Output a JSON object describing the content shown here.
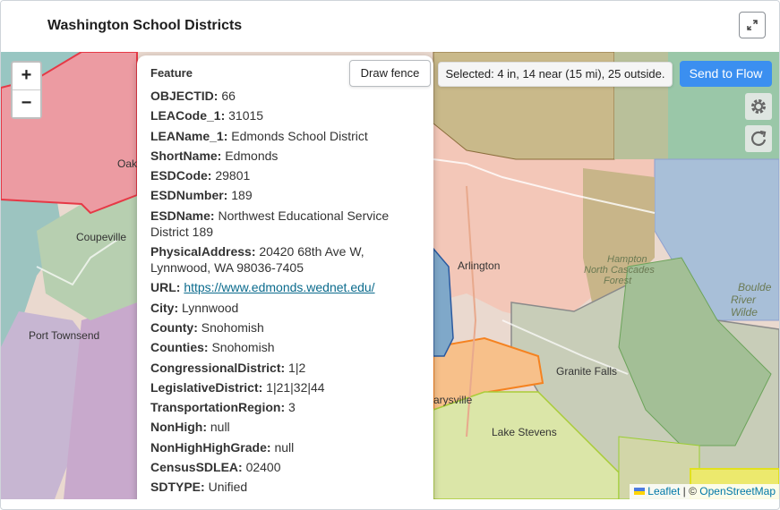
{
  "header": {
    "title": "Washington School Districts"
  },
  "map": {
    "zoom_in_label": "+",
    "zoom_out_label": "−",
    "place_labels": [
      "Oak",
      "Coupeville",
      "Port Townsend",
      "Arlington",
      "Hampton",
      "North Cascades",
      "Forest",
      "Boulde",
      "River Wilde",
      "Granite Falls",
      "arysville",
      "Lake Stevens"
    ]
  },
  "popup": {
    "heading": "Feature",
    "fields": [
      {
        "key": "OBJECTID:",
        "value": "66"
      },
      {
        "key": "LEACode_1:",
        "value": "31015"
      },
      {
        "key": "LEAName_1:",
        "value": "Edmonds School District"
      },
      {
        "key": "ShortName:",
        "value": "Edmonds"
      },
      {
        "key": "ESDCode:",
        "value": "29801"
      },
      {
        "key": "ESDNumber:",
        "value": "189"
      },
      {
        "key": "ESDName:",
        "value": "Northwest Educational Service District 189"
      },
      {
        "key": "PhysicalAddress:",
        "value": "20420 68th Ave W, Lynnwood, WA 98036-7405"
      },
      {
        "key": "URL:",
        "value": "https://www.edmonds.wednet.edu/",
        "link": true
      },
      {
        "key": "City:",
        "value": "Lynnwood"
      },
      {
        "key": "County:",
        "value": "Snohomish"
      },
      {
        "key": "Counties:",
        "value": "Snohomish"
      },
      {
        "key": "CongressionalDistrict:",
        "value": "1|2"
      },
      {
        "key": "LegislativeDistrict:",
        "value": "1|21|32|44"
      },
      {
        "key": "TransportationRegion:",
        "value": "3"
      },
      {
        "key": "NonHigh:",
        "value": "null"
      },
      {
        "key": "NonHighHighGrade:",
        "value": "null"
      },
      {
        "key": "CensusSDLEA:",
        "value": "02400"
      },
      {
        "key": "SDTYPE:",
        "value": "Unified"
      }
    ]
  },
  "toolbar": {
    "draw_fence_label": "Draw fence",
    "selected_text": "Selected: 4 in, 14 near (15 mi), 25 outside.",
    "send_to_flow_label": "Send to Flow"
  },
  "attribution": {
    "leaflet": "Leaflet",
    "separator": " | © ",
    "osm": "OpenStreetMap"
  },
  "colors": {
    "accent": "#3b8ff0",
    "district_red": "#e63946",
    "district_orange": "#f58220",
    "district_green": "#9acd32"
  }
}
